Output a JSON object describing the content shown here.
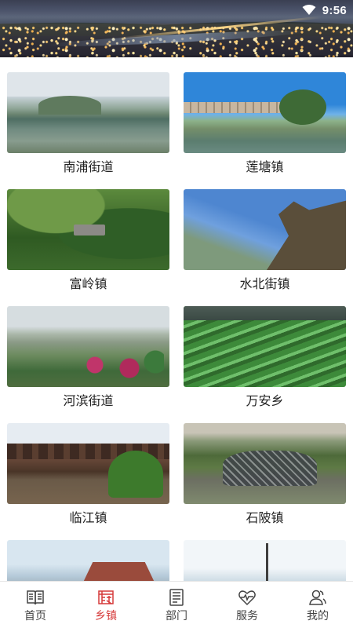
{
  "status_bar": {
    "time": "9:56",
    "wifi_icon": "wifi-icon"
  },
  "header": {
    "banner_image": "night city skyline aerial view"
  },
  "towns": [
    {
      "name": "南浦街道",
      "photo": "lake with green hill"
    },
    {
      "name": "莲塘镇",
      "photo": "covered bridge over river"
    },
    {
      "name": "富岭镇",
      "photo": "green mountain valley village"
    },
    {
      "name": "水北街镇",
      "photo": "rocky cliff under blue sky"
    },
    {
      "name": "河滨街道",
      "photo": "riverside willows and flowers"
    },
    {
      "name": "万安乡",
      "photo": "terraced fields"
    },
    {
      "name": "临江镇",
      "photo": "wooden covered bridge"
    },
    {
      "name": "石陂镇",
      "photo": "village in mountain valley"
    },
    {
      "name": "",
      "photo": "building with red roof"
    },
    {
      "name": "",
      "photo": "street lamp and hills"
    }
  ],
  "tabbar": {
    "active_color": "#d63a3a",
    "items": [
      {
        "label": "首页",
        "icon": "book-icon",
        "active": false
      },
      {
        "label": "乡镇",
        "icon": "town-icon",
        "active": true
      },
      {
        "label": "部门",
        "icon": "document-icon",
        "active": false
      },
      {
        "label": "服务",
        "icon": "heart-pulse-icon",
        "active": false
      },
      {
        "label": "我的",
        "icon": "user-icon",
        "active": false
      }
    ]
  }
}
